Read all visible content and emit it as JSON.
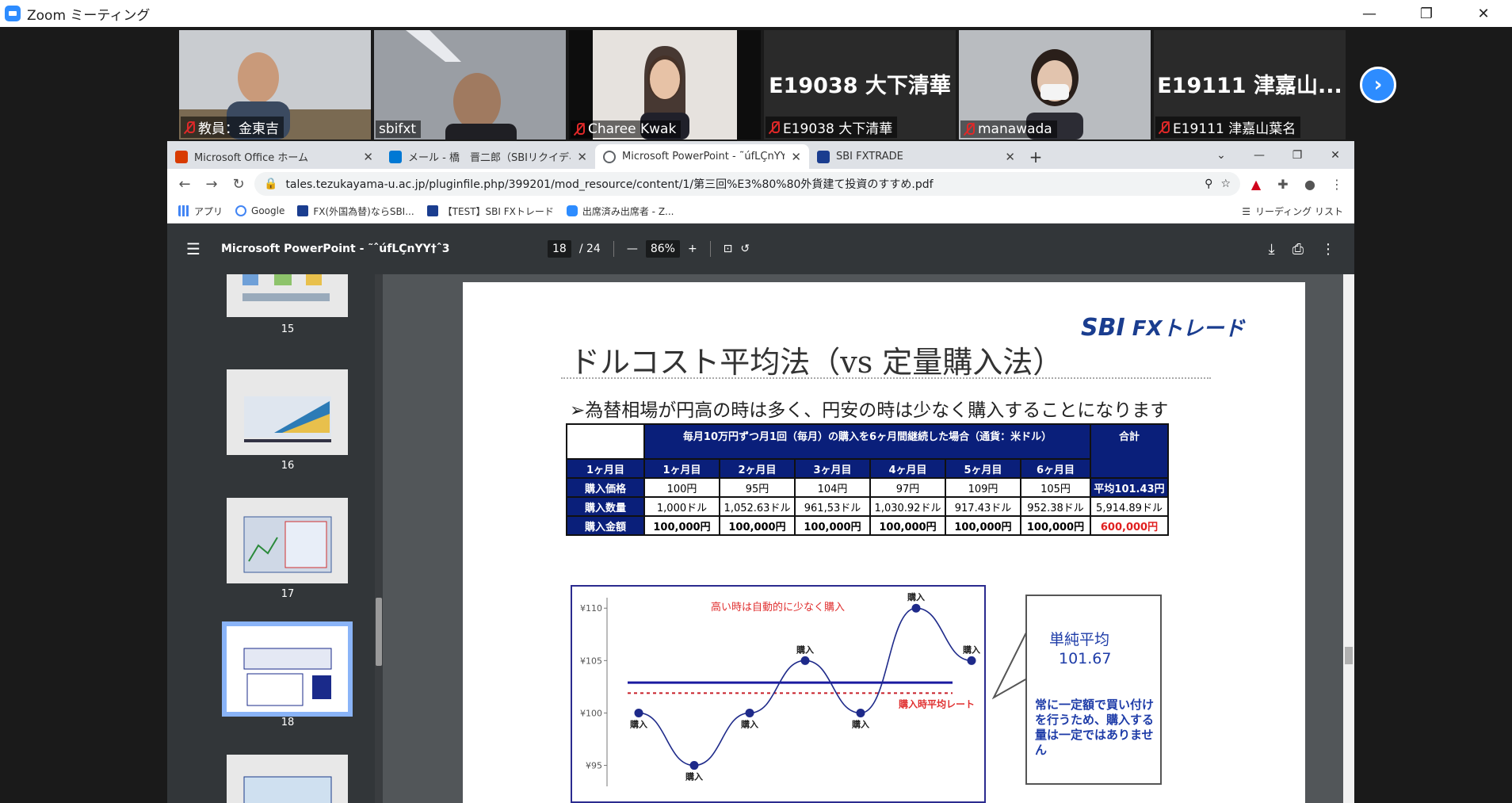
{
  "zoom": {
    "window_title": "Zoom ミーティング",
    "controls": {
      "minimize": "—",
      "restore": "❐",
      "close": "✕"
    }
  },
  "participants": [
    {
      "name": "教員：金東吉",
      "muted": true,
      "video": true
    },
    {
      "name": "sbifxt",
      "muted": false,
      "video": true,
      "active_speaker": true
    },
    {
      "name": "Charee Kwak",
      "muted": true,
      "video": true
    },
    {
      "name": "E19038 大下清華",
      "display_name": "E19038 大下清華",
      "muted": true,
      "video": false
    },
    {
      "name": "manawada",
      "muted": true,
      "video": true
    },
    {
      "name": "E19111 津嘉山葉名",
      "display_name": "E19111 津嘉山...",
      "muted": true,
      "video": false
    }
  ],
  "browser": {
    "tabs": [
      {
        "title": "Microsoft Office ホーム",
        "color": "#d83b01"
      },
      {
        "title": "メール - 橋　晋二郎（SBIリクイディティ",
        "color": "#0078d4"
      },
      {
        "title": "Microsoft PowerPoint - ˜úfLÇnYY",
        "color": "#5f6368",
        "active": true
      },
      {
        "title": "SBI FXTRADE",
        "color": "#1a3d8f"
      }
    ],
    "url": "tales.tezukayama-u.ac.jp/pluginfile.php/399201/mod_resource/content/1/第三回%E3%80%80外貨建て投資のすすめ.pdf",
    "bookmarks": [
      {
        "label": "アプリ"
      },
      {
        "label": "Google"
      },
      {
        "label": "FX(外国為替)ならSBI..."
      },
      {
        "label": "【TEST】SBI FXトレード"
      },
      {
        "label": "出席済み出席者 - Z..."
      }
    ],
    "reading_list": "リーディング リスト"
  },
  "pdf": {
    "title": "Microsoft PowerPoint - ˜ˆúfLÇnYY†ˆ3",
    "current_page": "18",
    "total_pages": "/ 24",
    "zoom": "86%",
    "thumbnails": [
      "15",
      "16",
      "17",
      "18"
    ]
  },
  "slide": {
    "logo_sbi": "SBI",
    "logo_fx": "FXトレード",
    "title": "ドルコスト平均法（vs 定量購入法）",
    "bullet": "➢為替相場が円高の時は多く、円安の時は少なく購入することになります",
    "table": {
      "header": "毎月10万円ずつ月1回（毎月）の購入を6ヶ月間継続した場合（通貨：米ドル）",
      "total_header": "合計",
      "row_label_header": "1ヶ月目",
      "months": [
        "1ヶ月目",
        "2ヶ月目",
        "3ヶ月目",
        "4ヶ月目",
        "5ヶ月目",
        "6ヶ月目"
      ],
      "rows": [
        {
          "label": "購入価格",
          "values": [
            "100円",
            "95円",
            "104円",
            "97円",
            "109円",
            "105円"
          ],
          "total": "平均101.43円"
        },
        {
          "label": "購入数量",
          "values": [
            "1,000ドル",
            "1,052.63ドル",
            "961,53ドル",
            "1,030.92ドル",
            "917.43ドル",
            "952.38ドル"
          ],
          "total": "5,914.89ドル"
        },
        {
          "label": "購入金額",
          "values": [
            "100,000円",
            "100,000円",
            "100,000円",
            "100,000円",
            "100,000円",
            "100,000円"
          ],
          "total": "600,000円"
        }
      ]
    },
    "note": {
      "avg_label": "単純平均",
      "avg_value": "101.67",
      "text": "常に一定額で買い付けを行うため、購入する量は一定ではありません"
    }
  },
  "chart_data": {
    "type": "line",
    "yticks": [
      "¥110",
      "¥105",
      "¥100",
      "¥95"
    ],
    "ylim": [
      93,
      111
    ],
    "points": [
      {
        "y": 100,
        "label": "購入"
      },
      {
        "y": 95,
        "label": "購入"
      },
      {
        "y": 100,
        "label": "購入"
      },
      {
        "y": 105,
        "label": "購入"
      },
      {
        "y": 100,
        "label": "購入"
      },
      {
        "y": 110,
        "label": "購入"
      },
      {
        "y": 105,
        "label": "購入"
      }
    ],
    "avg_line": 102.9,
    "purchase_avg": 101.9,
    "annotation_top": "高い時は自動的に少なく購入",
    "annotation_avg": "購入時平均レート",
    "colors": {
      "curve": "#1e2a8a",
      "avg": "#1a1aa0",
      "purchase_avg": "#c81e28",
      "annotation": "#e03030"
    }
  }
}
